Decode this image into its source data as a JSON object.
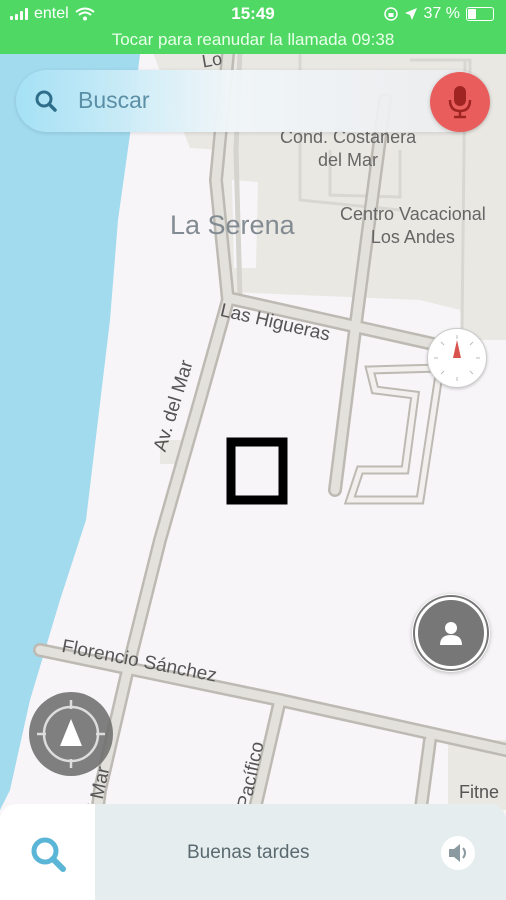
{
  "status_bar": {
    "carrier": "entel",
    "time": "15:49",
    "battery": "37 %",
    "battery_level": 0.37,
    "call_banner": "Tocar para reanudar la llamada 09:38"
  },
  "search": {
    "placeholder": "Buscar"
  },
  "map": {
    "labels": {
      "top_partial": "Lo",
      "condominium": "Cond. Costanera\ndel Mar",
      "city": "La Serena",
      "resort": "Centro Vacacional\nLos Andes",
      "street_higueras": "Las Higueras",
      "street_av_mar": "Av. del Mar",
      "street_florencio": "Florencio Sánchez",
      "street_pacifico": "Pacífico",
      "street_av_mar_lower": "l Mar",
      "fitness_partial": "Fitne"
    }
  },
  "bottom_bar": {
    "greeting": "Buenas tardes"
  },
  "colors": {
    "status_green": "#4fd964",
    "water": "#a2daee",
    "mic_red": "#e95e5c",
    "search_blue": "#5ab5d6"
  }
}
